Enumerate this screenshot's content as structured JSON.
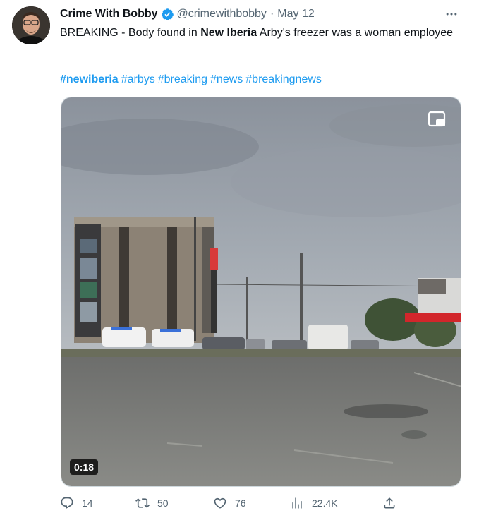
{
  "author": {
    "display_name": "Crime With Bobby",
    "handle": "@crimewithbobby",
    "separator": "·",
    "date": "May 12"
  },
  "tweet": {
    "text_part1": "BREAKING - Body found in ",
    "text_bold": "New Iberia",
    "text_part2": " Arby's freezer was a woman employee",
    "hashtags": [
      "#newiberia",
      "#arbys",
      "#breaking",
      "#news",
      "#breakingnews"
    ]
  },
  "media": {
    "duration": "0:18"
  },
  "metrics": {
    "replies": "14",
    "reposts": "50",
    "likes": "76",
    "views": "22.4K"
  },
  "icons": {
    "verified": "verified-badge-icon",
    "more": "more-dots-icon",
    "pip": "picture-in-picture-icon",
    "reply": "reply-icon",
    "repost": "repost-icon",
    "like": "heart-icon",
    "views": "views-bar-chart-icon",
    "share": "share-icon"
  },
  "colors": {
    "link": "#1d9bf0",
    "secondary_text": "#536471",
    "verified": "#1d9bf0"
  }
}
